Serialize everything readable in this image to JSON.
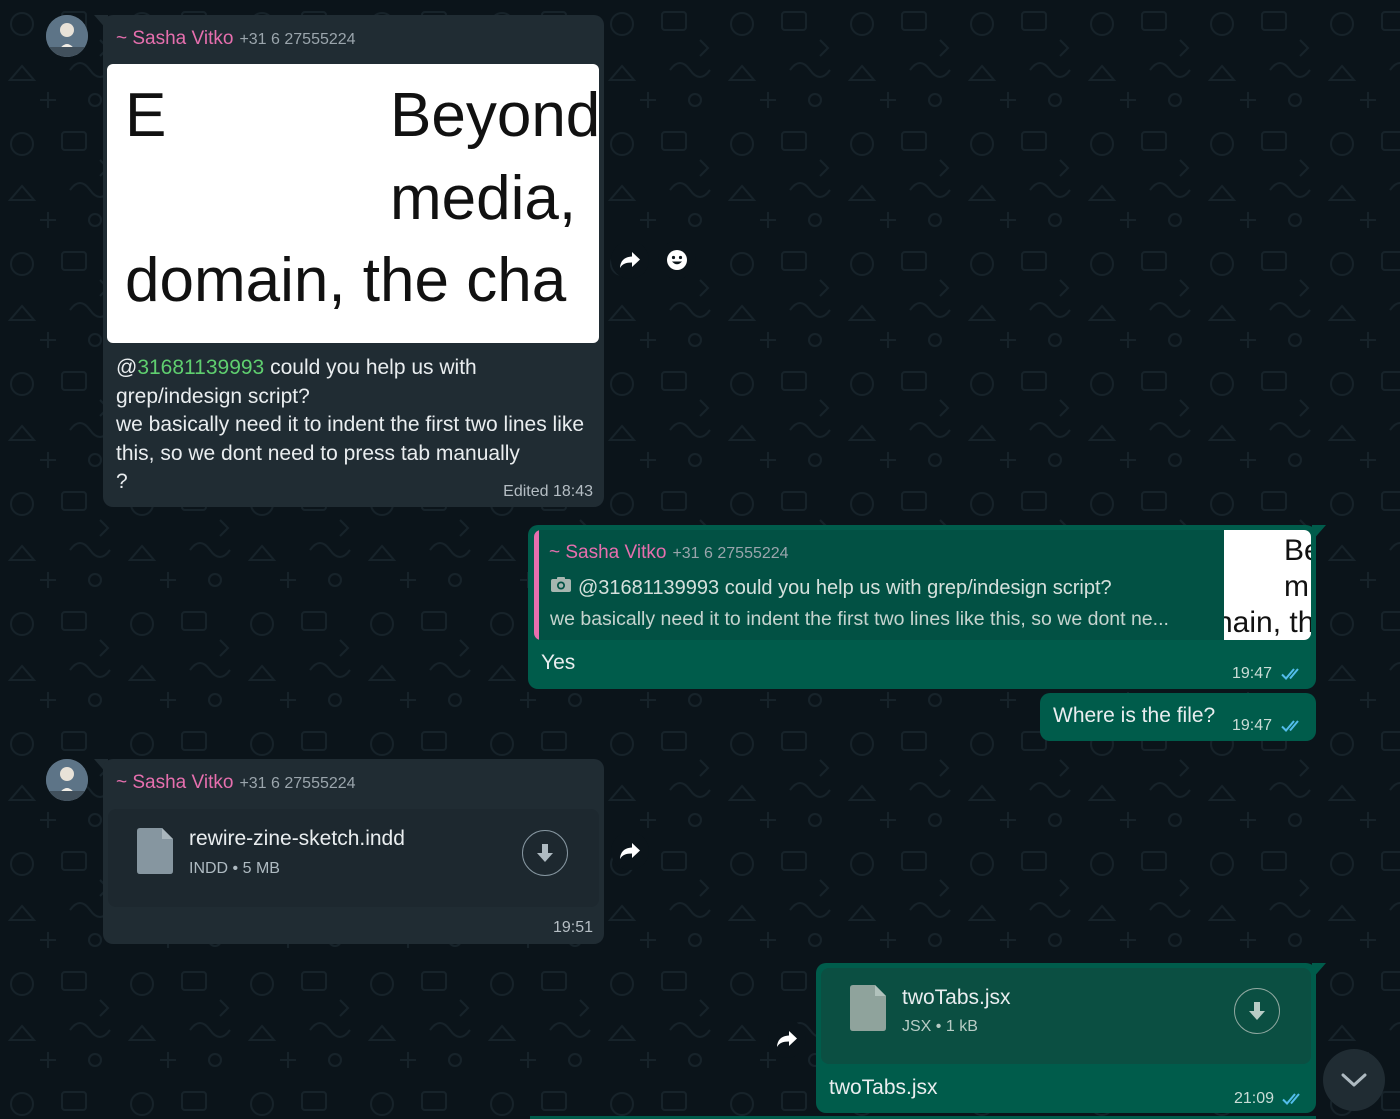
{
  "messages": {
    "m1": {
      "sender_name": "~ Sasha Vitko",
      "sender_phone": "+31 6 27555224",
      "image_text": {
        "l1a": "E",
        "l1b": "Beyond",
        "l2": "media,",
        "l3": "domain, the cha"
      },
      "mention": "31681139993",
      "text_after_mention": " could you help us with grep/indesign script?",
      "text_line2": "we basically need it to indent the first two lines like this, so we dont need to press tab manually",
      "text_line3": "?",
      "meta": "Edited 18:43"
    },
    "m2": {
      "quote_sender_name": "~ Sasha Vitko",
      "quote_sender_phone": "+31 6 27555224",
      "quote_line1": "@31681139993 could you help us with grep/indesign script?",
      "quote_line2": "we basically need it to indent the first two lines like this, so we dont ne...",
      "quote_thumb": {
        "l1": "Be",
        "l2": "m",
        "l3": "nain, th"
      },
      "text": "Yes",
      "time": "19:47"
    },
    "m3": {
      "text": "Where is the file?",
      "time": "19:47"
    },
    "m4": {
      "sender_name": "~ Sasha Vitko",
      "sender_phone": "+31 6 27555224",
      "file_name": "rewire-zine-sketch.indd",
      "file_type": "INDD",
      "file_size": "5 MB",
      "time": "19:51"
    },
    "m5": {
      "file_name": "twoTabs.jsx",
      "file_type": "JSX",
      "file_size": "1 kB",
      "caption": "twoTabs.jsx",
      "time": "21:09"
    }
  },
  "icons": {
    "forward": "forward-arrow-icon",
    "emoji": "smiley-icon",
    "download": "download-arrow-icon",
    "file": "document-icon",
    "camera": "camera-icon",
    "ticks": "double-check-icon",
    "scroll": "chevron-down-icon"
  },
  "colors": {
    "background": "#0b141a",
    "incoming_bubble": "#202c33",
    "outgoing_bubble": "#005c4b",
    "sender_name": "#e66fae",
    "mention": "#53bdeb",
    "read_ticks": "#53bdeb"
  }
}
